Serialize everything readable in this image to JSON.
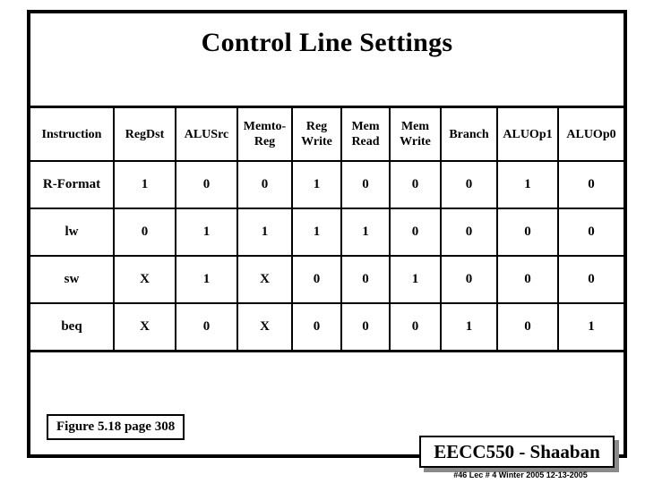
{
  "slide": {
    "title": "Control Line Settings",
    "figure_caption": "Figure 5.18 page 308"
  },
  "table": {
    "columns": [
      {
        "id": "instruction",
        "label": "Instruction",
        "lines": [
          "Instruction"
        ]
      },
      {
        "id": "regdst",
        "label": "RegDst",
        "lines": [
          "RegDst"
        ]
      },
      {
        "id": "alusrc",
        "label": "ALUSrc",
        "lines": [
          "ALUSrc"
        ]
      },
      {
        "id": "memtoreg",
        "label": "Memto-Reg",
        "lines": [
          "Memto-",
          "Reg"
        ]
      },
      {
        "id": "regwrite",
        "label": "Reg Write",
        "lines": [
          "Reg",
          "Write"
        ]
      },
      {
        "id": "memread",
        "label": "Mem Read",
        "lines": [
          "Mem",
          "Read"
        ]
      },
      {
        "id": "memwrite",
        "label": "Mem Write",
        "lines": [
          "Mem",
          "Write"
        ]
      },
      {
        "id": "branch",
        "label": "Branch",
        "lines": [
          "Branch"
        ]
      },
      {
        "id": "aluop1",
        "label": "ALUOp1",
        "lines": [
          "ALUOp1"
        ]
      },
      {
        "id": "aluop0",
        "label": "ALUOp0",
        "lines": [
          "ALUOp0"
        ]
      }
    ],
    "rows": [
      {
        "instruction": "R-Format",
        "values": [
          "1",
          "0",
          "0",
          "1",
          "0",
          "0",
          "0",
          "1",
          "0"
        ]
      },
      {
        "instruction": "lw",
        "values": [
          "0",
          "1",
          "1",
          "1",
          "1",
          "0",
          "0",
          "0",
          "0"
        ]
      },
      {
        "instruction": "sw",
        "values": [
          "X",
          "1",
          "X",
          "0",
          "0",
          "1",
          "0",
          "0",
          "0"
        ]
      },
      {
        "instruction": "beq",
        "values": [
          "X",
          "0",
          "X",
          "0",
          "0",
          "0",
          "1",
          "0",
          "1"
        ]
      }
    ]
  },
  "footer": {
    "badge_label": "EECC550 - Shaaban",
    "subtext": "#46   Lec # 4   Winter 2005   12-13-2005"
  },
  "colors": {
    "ink": "#000000",
    "paper": "#ffffff",
    "shadow": "#8a8a8a"
  }
}
